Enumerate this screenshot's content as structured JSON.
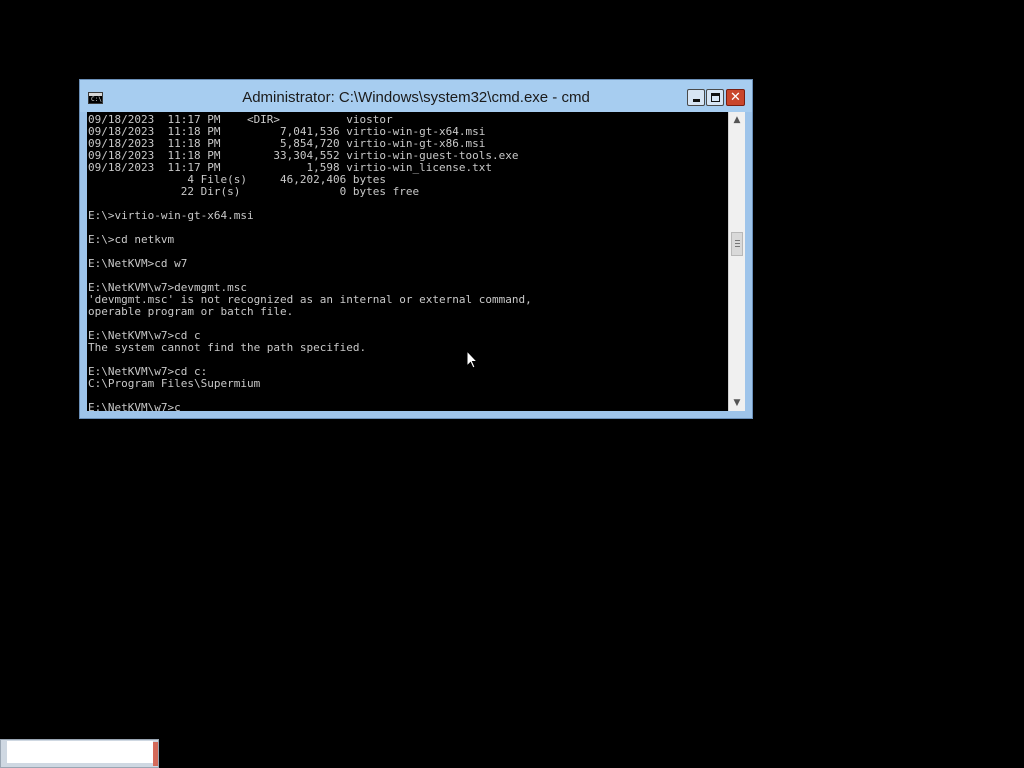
{
  "window": {
    "title": "Administrator: C:\\Windows\\system32\\cmd.exe - cmd",
    "icon_glyph": "C:\\",
    "close_glyph": "✕"
  },
  "console": {
    "lines": [
      "09/18/2023  11:17 PM    <DIR>          viostor",
      "09/18/2023  11:18 PM         7,041,536 virtio-win-gt-x64.msi",
      "09/18/2023  11:18 PM         5,854,720 virtio-win-gt-x86.msi",
      "09/18/2023  11:18 PM        33,304,552 virtio-win-guest-tools.exe",
      "09/18/2023  11:17 PM             1,598 virtio-win_license.txt",
      "               4 File(s)     46,202,406 bytes",
      "              22 Dir(s)               0 bytes free",
      "",
      "E:\\>virtio-win-gt-x64.msi",
      "",
      "E:\\>cd netkvm",
      "",
      "E:\\NetKVM>cd w7",
      "",
      "E:\\NetKVM\\w7>devmgmt.msc",
      "'devmgmt.msc' is not recognized as an internal or external command,",
      "operable program or batch file.",
      "",
      "E:\\NetKVM\\w7>cd c",
      "The system cannot find the path specified.",
      "",
      "E:\\NetKVM\\w7>cd c:",
      "C:\\Program Files\\Supermium",
      ""
    ],
    "prompt_line": "E:\\NetKVM\\w7>c"
  },
  "colors": {
    "title_bar": "#a7cdf0",
    "console_bg": "#000000",
    "console_text": "#c9c9c9",
    "close_button": "#c9462c"
  }
}
